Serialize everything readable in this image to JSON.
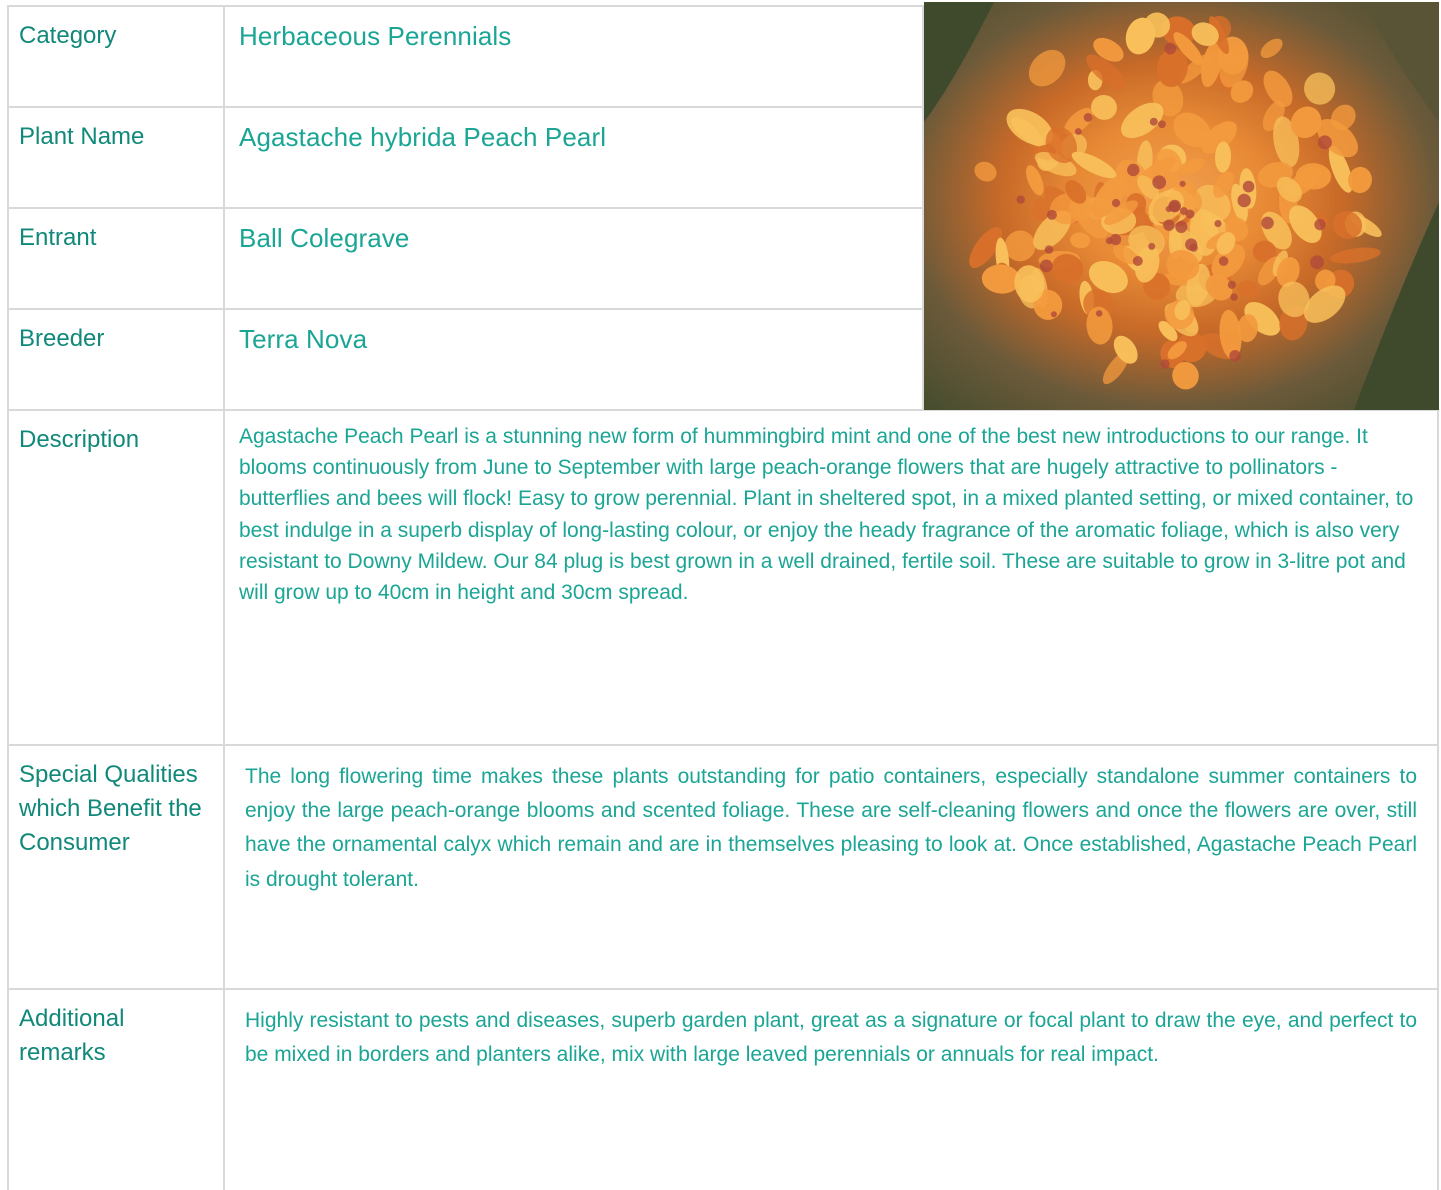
{
  "rows": [
    {
      "label": "Category",
      "value": "Herbaceous Perennials"
    },
    {
      "label": "Plant Name",
      "value": "Agastache hybrida Peach Pearl"
    },
    {
      "label": "Entrant",
      "value": "Ball Colegrave"
    },
    {
      "label": "Breeder",
      "value": "Terra Nova"
    }
  ],
  "description": {
    "label": "Description",
    "text": "Agastache Peach Pearl is a stunning new form of hummingbird mint and one of the best new introductions to our range. It blooms continuously from June to September with large peach-orange flowers that are hugely attractive to pollinators - butterflies and bees will flock! Easy to grow perennial. Plant in sheltered spot, in a mixed planted setting, or mixed container, to best indulge in a superb display of long-lasting colour, or enjoy the heady fragrance of the aromatic foliage, which is also very resistant to Downy Mildew. Our 84 plug is best grown in a well drained, fertile soil. These are suitable to grow in 3-litre pot and will grow up to 40cm in height and 30cm spread."
  },
  "special_qualities": {
    "label": "Special Qualities which Benefit the Consumer",
    "text": "The long flowering time makes these plants outstanding for patio containers, especially standalone summer containers to enjoy the large peach-orange blooms and scented foliage.  These are self-cleaning flowers and once the flowers are over, still have the ornamental calyx which remain and are in themselves pleasing to look at. Once established, Agastache Peach Pearl is drought tolerant."
  },
  "additional_remarks": {
    "label": "Additional remarks",
    "text": "Highly resistant to pests and diseases, superb garden plant, great as a signature or focal plant to draw the eye, and perfect to be mixed in borders and planters alike, mix with large leaved perennials or annuals for real impact."
  },
  "photo": {
    "icon": "agastache-flower-photo",
    "colors": {
      "petal": "#f39a3e",
      "petal_light": "#f8bf5a",
      "petal_dark": "#d9702a",
      "calyx": "#b04a3a",
      "foliage": "#3f4a2c"
    }
  },
  "colors": {
    "label_text": "#11897a",
    "value_text": "#1aa595",
    "grid_line": "#d9d9d9"
  }
}
